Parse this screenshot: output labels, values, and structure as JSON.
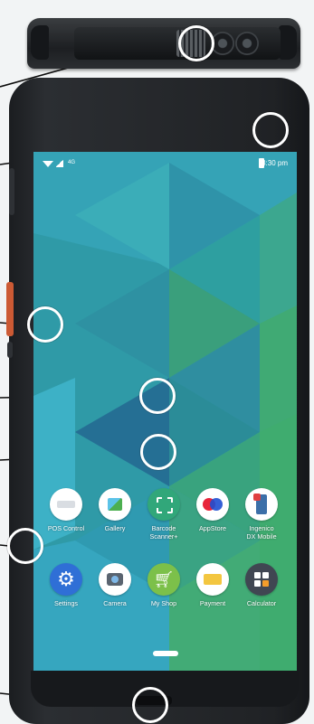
{
  "statusbar": {
    "time": "3:30 pm",
    "network": "4G"
  },
  "apps": {
    "row1": [
      {
        "label": "POS Control",
        "icon": "pos-control-icon",
        "color": "#ffffff"
      },
      {
        "label": "Gallery",
        "icon": "gallery-icon",
        "color": "#ffffff"
      },
      {
        "label": "Barcode\nScanner+",
        "icon": "barcode-scanner-icon",
        "color": "#31a77a"
      },
      {
        "label": "AppStore",
        "icon": "appstore-icon",
        "color": "#ffffff"
      },
      {
        "label": "Ingenico\nDX Mobile",
        "icon": "ingenico-icon",
        "color": "#ffffff"
      }
    ],
    "row2": [
      {
        "label": "Settings",
        "icon": "gear-icon",
        "color": "#2f6fd6"
      },
      {
        "label": "Camera",
        "icon": "camera-icon",
        "color": "#ffffff"
      },
      {
        "label": "My Shop",
        "icon": "cart-icon",
        "color": "#7cc04a"
      },
      {
        "label": "Payment",
        "icon": "payment-icon",
        "color": "#ffffff"
      },
      {
        "label": "Calculator",
        "icon": "calculator-icon",
        "color": "#404652"
      }
    ]
  },
  "colors": {
    "wall_base": "#2f9aa7",
    "wall_green": "#3da86a",
    "callout": "#ffffff",
    "leader": "#0b0b0b"
  }
}
